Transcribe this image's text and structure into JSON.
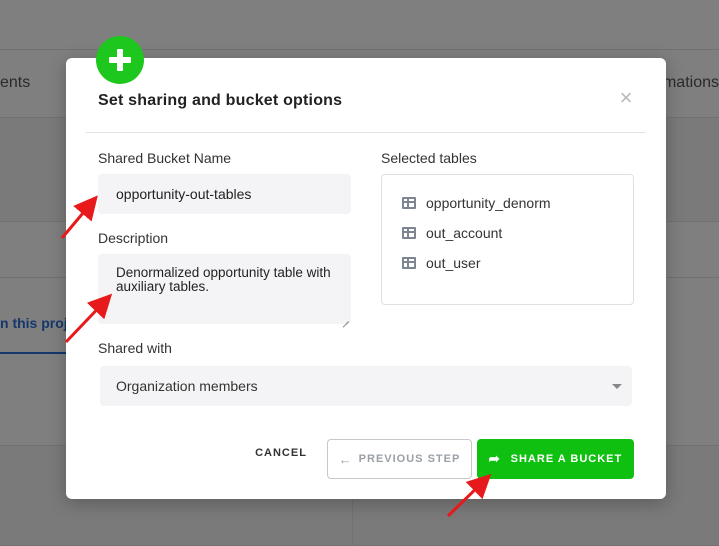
{
  "background": {
    "tab_left_fragment": "ents",
    "tab_right_fragment": "mations",
    "link_fragment": "n this proj"
  },
  "modal": {
    "title": "Set sharing and bucket options",
    "close_glyph": "×",
    "shared_bucket_name_label": "Shared Bucket Name",
    "shared_bucket_name_value": "opportunity-out-tables",
    "description_label": "Description",
    "description_value": "Denormalized opportunity table with auxiliary tables.",
    "selected_tables_label": "Selected tables",
    "selected_tables": [
      {
        "name": "opportunity_denorm",
        "icon": "table-icon"
      },
      {
        "name": "out_account",
        "icon": "table-icon"
      },
      {
        "name": "out_user",
        "icon": "table-icon"
      }
    ],
    "shared_with_label": "Shared with",
    "shared_with_value": "Organization members",
    "buttons": {
      "cancel": "CANCEL",
      "previous": "PREVIOUS STEP",
      "share": "SHARE A BUCKET"
    },
    "badge_icon": "plus-icon"
  },
  "colors": {
    "accent_green": "#10c010",
    "badge_green": "#1ec71e",
    "annotation_arrow": "#e8191a"
  }
}
